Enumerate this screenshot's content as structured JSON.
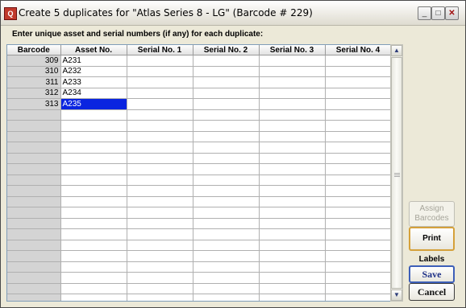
{
  "window": {
    "title": "Create 5 duplicates for \"Atlas Series 8 - LG\"  (Barcode # 229)",
    "icon": "app-logo-icon"
  },
  "titlebar_buttons": {
    "minimize": "_",
    "maximize": "□",
    "close": "✕"
  },
  "instructions": "Enter unique asset and serial numbers (if any) for each duplicate:",
  "grid": {
    "columns": [
      "Barcode",
      "Asset No.",
      "Serial No. 1",
      "Serial No. 2",
      "Serial No. 3",
      "Serial No. 4"
    ],
    "rows": [
      {
        "barcode": "309",
        "asset": "A231",
        "s1": "",
        "s2": "",
        "s3": "",
        "s4": ""
      },
      {
        "barcode": "310",
        "asset": "A232",
        "s1": "",
        "s2": "",
        "s3": "",
        "s4": ""
      },
      {
        "barcode": "311",
        "asset": "A233",
        "s1": "",
        "s2": "",
        "s3": "",
        "s4": ""
      },
      {
        "barcode": "312",
        "asset": "A234",
        "s1": "",
        "s2": "",
        "s3": "",
        "s4": ""
      },
      {
        "barcode": "313",
        "asset": "A235",
        "s1": "",
        "s2": "",
        "s3": "",
        "s4": ""
      }
    ],
    "selected_row": 4,
    "selected_column": "asset",
    "empty_row_count": 18
  },
  "scrollbar": {
    "up": "▲",
    "down": "▼"
  },
  "buttons": {
    "assign_barcodes": "Assign Barcodes",
    "print_labels": "Print Labels",
    "save": "Save",
    "cancel": "Cancel"
  }
}
